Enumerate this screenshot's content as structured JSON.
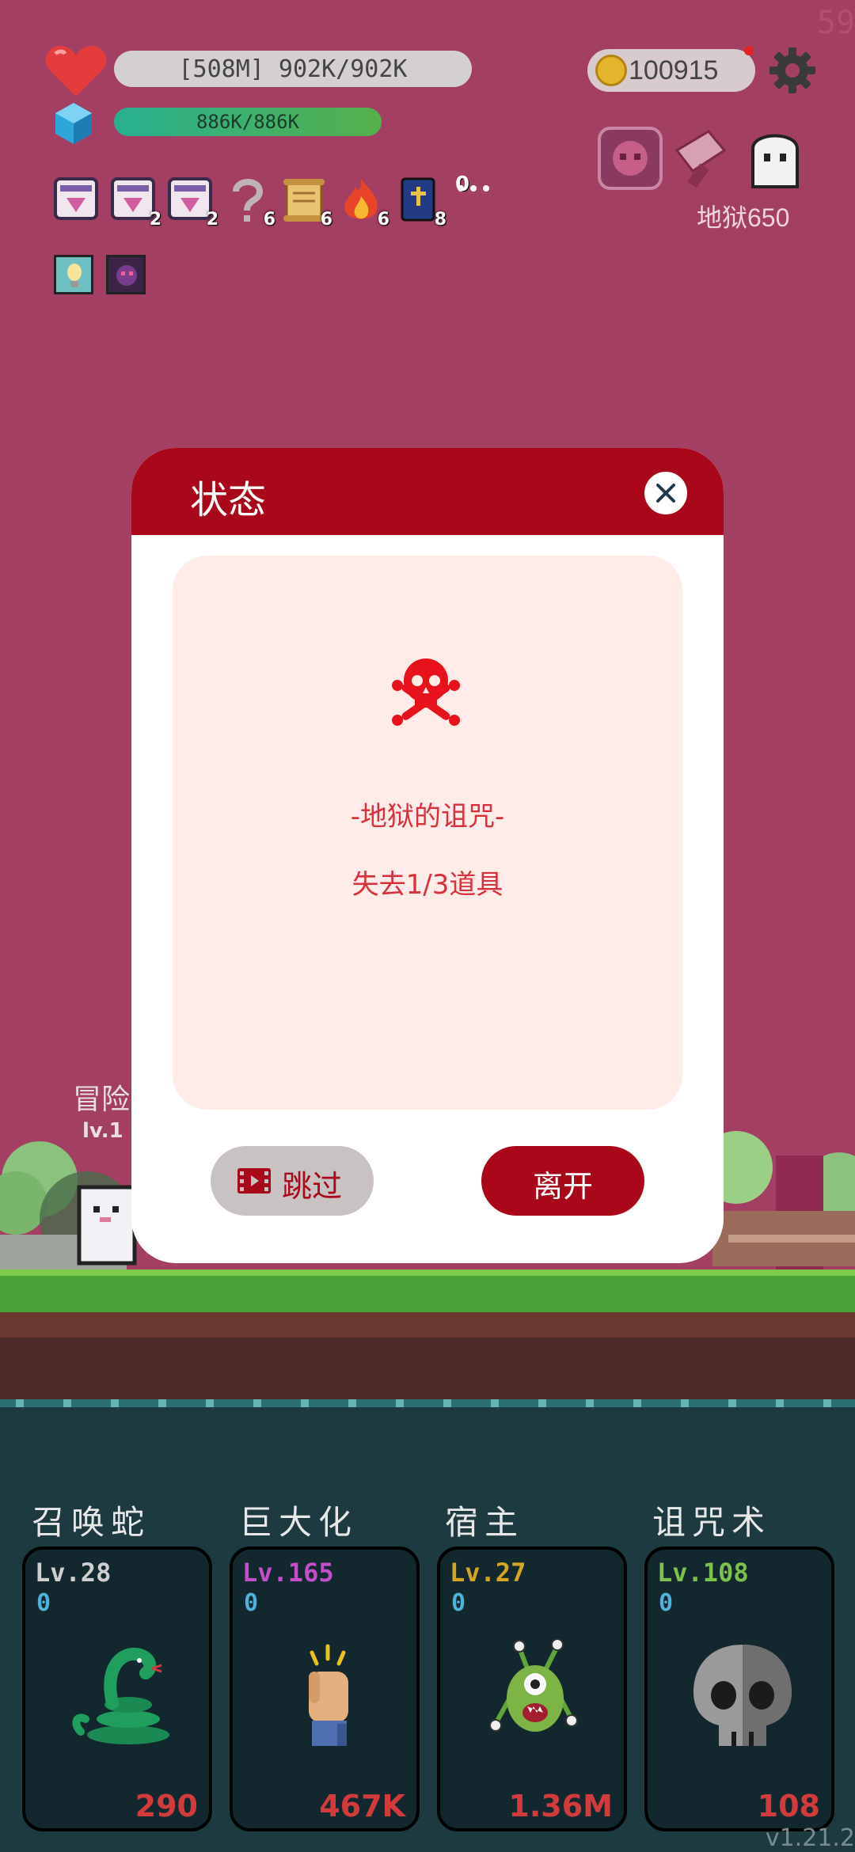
{
  "fps": "59",
  "hud": {
    "hp_text": "[508M] 902K/902K",
    "mp_text": "886K/886K",
    "coins": "100915",
    "hell_label": "地狱650"
  },
  "items": [
    {
      "icon": "scroll-card-icon",
      "count": ""
    },
    {
      "icon": "scroll-card-icon",
      "count": "2"
    },
    {
      "icon": "scroll-card-icon",
      "count": "2"
    },
    {
      "icon": "question-mark-icon",
      "count": "6"
    },
    {
      "icon": "map-scroll-icon",
      "count": "6"
    },
    {
      "icon": "fire-icon",
      "count": "6"
    },
    {
      "icon": "holy-book-icon",
      "count": "8"
    }
  ],
  "items_more_count": "0",
  "scene": {
    "adventurer_label": "冒险",
    "level_label": "lv.1"
  },
  "dialog": {
    "title": "状态",
    "curse_title": "-地狱的诅咒-",
    "curse_desc": "失去1/3道具",
    "skip_label": "跳过",
    "leave_label": "离开"
  },
  "skills": [
    {
      "name": "召唤蛇",
      "level": "Lv.28",
      "level_color": "#cfcfcf",
      "counter": "0",
      "cost": "290",
      "icon": "snake-icon"
    },
    {
      "name": "巨大化",
      "level": "Lv.165",
      "level_color": "#c24fc9",
      "counter": "0",
      "cost": "467K",
      "icon": "fist-icon"
    },
    {
      "name": "宿主",
      "level": "Lv.27",
      "level_color": "#d4a624",
      "counter": "0",
      "cost": "1.36M",
      "icon": "monster-icon"
    },
    {
      "name": "诅咒术",
      "level": "Lv.108",
      "level_color": "#7bc24d",
      "counter": "0",
      "cost": "108",
      "icon": "skull-icon"
    }
  ],
  "version": "v1.21.2"
}
